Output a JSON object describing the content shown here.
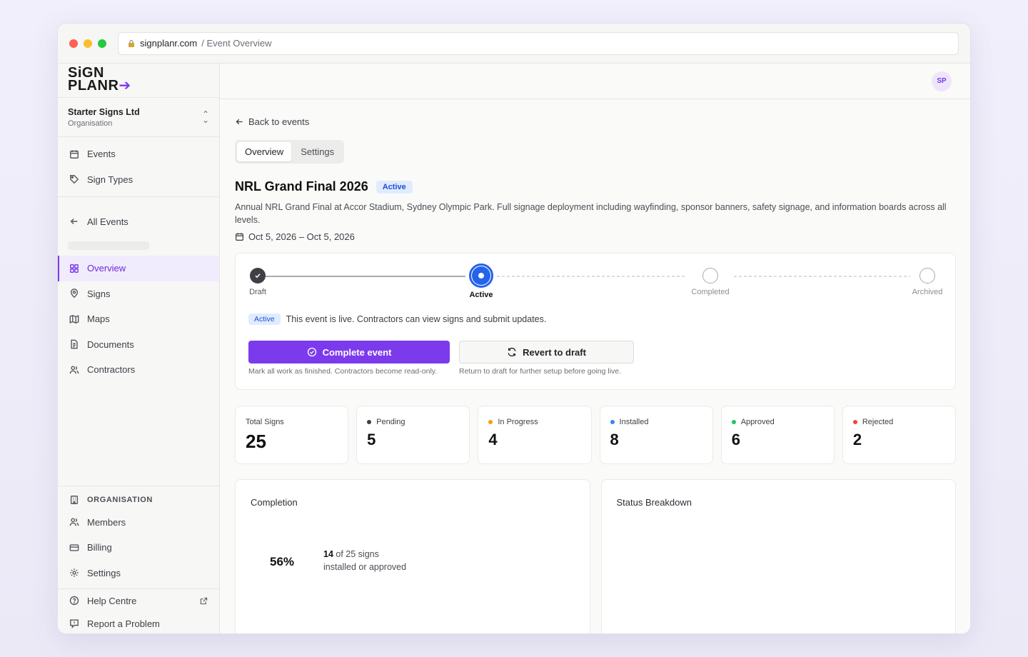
{
  "browser": {
    "domain": "signplanr.com",
    "path": "/ Event Overview"
  },
  "brand": {
    "line1": "SiGN",
    "line2": "PLANR",
    "accent": "#7c3aed"
  },
  "org": {
    "name": "Starter Signs Ltd",
    "sub": "Organisation"
  },
  "nav_primary": [
    {
      "label": "Events",
      "icon": "calendar-icon"
    },
    {
      "label": "Sign Types",
      "icon": "tag-icon"
    }
  ],
  "all_events_label": "All Events",
  "nav_event": [
    {
      "label": "Overview",
      "icon": "grid-icon",
      "active": true
    },
    {
      "label": "Signs",
      "icon": "pin-icon"
    },
    {
      "label": "Maps",
      "icon": "map-icon"
    },
    {
      "label": "Documents",
      "icon": "document-icon"
    },
    {
      "label": "Contractors",
      "icon": "users-icon"
    }
  ],
  "org_section": {
    "label": "ORGANISATION",
    "items": [
      {
        "label": "Members",
        "icon": "users-icon"
      },
      {
        "label": "Billing",
        "icon": "card-icon"
      },
      {
        "label": "Settings",
        "icon": "gear-icon"
      }
    ]
  },
  "help": {
    "help_label": "Help Centre",
    "report_label": "Report a Problem"
  },
  "user": {
    "initials": "SP"
  },
  "back_label": "Back to events",
  "tabs": [
    {
      "label": "Overview",
      "active": true
    },
    {
      "label": "Settings"
    }
  ],
  "event": {
    "title": "NRL Grand Final 2026",
    "status": "Active",
    "description": "Annual NRL Grand Final at Accor Stadium, Sydney Olympic Park. Full signage deployment including wayfinding, sponsor banners, safety signage, and information boards across all levels.",
    "dates": "Oct 5, 2026 – Oct 5, 2026"
  },
  "lifecycle": {
    "steps": [
      "Draft",
      "Active",
      "Completed",
      "Archived"
    ],
    "current": 1,
    "status_badge": "Active",
    "status_text": "This event is live. Contractors can view signs and submit updates.",
    "primary_label": "Complete event",
    "primary_hint": "Mark all work as finished. Contractors become read-only.",
    "secondary_label": "Revert to draft",
    "secondary_hint": "Return to draft for further setup before going live."
  },
  "stats": [
    {
      "label": "Total Signs",
      "value": "25",
      "color": ""
    },
    {
      "label": "Pending",
      "value": "5",
      "color": "#3f3f46"
    },
    {
      "label": "In Progress",
      "value": "4",
      "color": "#f59e0b"
    },
    {
      "label": "Installed",
      "value": "8",
      "color": "#3b82f6"
    },
    {
      "label": "Approved",
      "value": "6",
      "color": "#22c55e"
    },
    {
      "label": "Rejected",
      "value": "2",
      "color": "#ef4444"
    }
  ],
  "completion": {
    "title": "Completion",
    "percent": "56%",
    "count": "14",
    "text_rest": " of 25 signs",
    "text_line2": "installed or approved"
  },
  "breakdown": {
    "title": "Status Breakdown"
  }
}
